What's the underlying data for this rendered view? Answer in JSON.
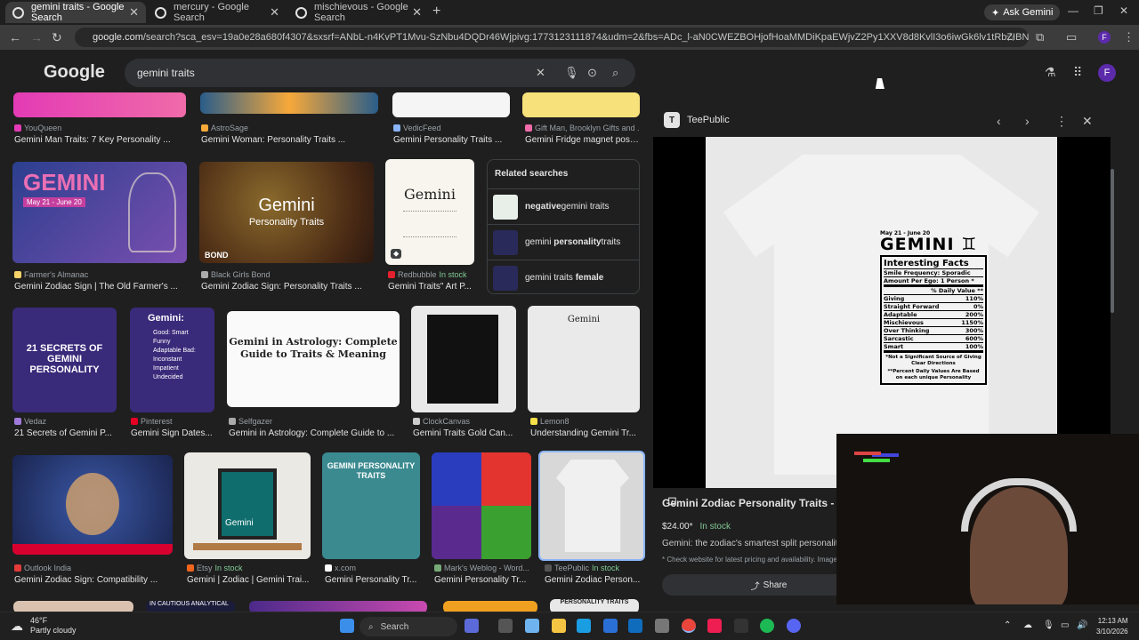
{
  "tabs": [
    {
      "title": "gemini traits - Google Search",
      "active": true
    },
    {
      "title": "mercury - Google Search",
      "active": false
    },
    {
      "title": "mischievous - Google Search",
      "active": false
    }
  ],
  "ask_gemini": "Ask Gemini",
  "url": {
    "host": "google.com",
    "path": "/search?sca_esv=19a0e28a680f4307&sxsrf=ANbL-n4KvPT1Mvu-SzNbu4DQDr46Wjpivg:1773123111874&udm=2&fbs=ADc_l-aN0CWEZBOHjofHoaMMDiKpaEWjvZ2Py1XXV8d8KvlI3o6iwGk6lv1tRbZIBNIVs-5-bUj3iBI-UxHsANYwOkWWI..."
  },
  "profile_initial": "F",
  "search": {
    "logo": "Google",
    "query": "gemini traits"
  },
  "row0": [
    {
      "source": "YouQueen",
      "title": "Gemini Man Traits: 7 Key Personality ...",
      "stock": ""
    },
    {
      "source": "AstroSage",
      "title": "Gemini Woman: Personality Traits ...",
      "stock": ""
    },
    {
      "source": "VedicFeed",
      "title": "Gemini Personality Traits ...",
      "stock": ""
    },
    {
      "source": "Gift Man, Brooklyn Gifts and ...",
      "title": "Gemini Fridge magnet posi...",
      "stock": ""
    }
  ],
  "row1": [
    {
      "source": "Farmer's Almanac",
      "title": "Gemini Zodiac Sign | The Old Farmer's ...",
      "stock": "",
      "img_text": "GEMINI",
      "img_sub": "May 21 - June 20"
    },
    {
      "source": "Black Girls Bond",
      "title": "Gemini Zodiac Sign: Personality Traits ...",
      "stock": "",
      "img_text": "Gemini",
      "img_sub": "Personality Traits",
      "img_mark": "BOND"
    },
    {
      "source": "Redbubble",
      "title": "Gemini Traits\" Art P...",
      "stock": "In stock",
      "img_text": "Gemini"
    }
  ],
  "related": {
    "heading": "Related searches",
    "items": [
      {
        "bold_prefix": "negative",
        "text": " gemini traits",
        "bold_suffix": ""
      },
      {
        "bold_prefix": "",
        "text": "gemini ",
        "bold_suffix": "personality",
        "tail": " traits"
      },
      {
        "bold_prefix": "",
        "text": "gemini traits ",
        "bold_suffix": "female",
        "tail": ""
      }
    ]
  },
  "row2": [
    {
      "source": "Vedaz",
      "title": "21 Secrets of Gemini P...",
      "stock": "",
      "img_text": "21 SECRETS OF GEMINI PERSONALITY"
    },
    {
      "source": "Pinterest",
      "title": "Gemini Sign Dates...",
      "stock": "",
      "img_text": "Gemini:",
      "img_lines": "Good: Smart Funny Adaptable Bad: Inconstant Impatient Undecided"
    },
    {
      "source": "Selfgazer",
      "title": "Gemini in Astrology: Complete Guide to ...",
      "stock": "",
      "img_text": "Gemini in Astrology: Complete Guide to Traits & Meaning"
    },
    {
      "source": "ClockCanvas",
      "title": "Gemini Traits Gold Can...",
      "stock": ""
    },
    {
      "source": "Lemon8",
      "title": "Understanding Gemini Tr...",
      "stock": "",
      "img_text": "Gemini"
    }
  ],
  "row3": [
    {
      "source": "Outlook India",
      "title": "Gemini Zodiac Sign: Compatibility ...",
      "stock": ""
    },
    {
      "source": "Etsy",
      "title": "Gemini | Zodiac | Gemini Trai...",
      "stock": "In stock",
      "img_text": "Gemini"
    },
    {
      "source": "x.com",
      "title": "Gemini Personality Tr...",
      "stock": "",
      "img_text": "GEMINI PERSONALITY TRAITS"
    },
    {
      "source": "Mark's Weblog - Word...",
      "title": "Gemini Personality Tr...",
      "stock": ""
    },
    {
      "source": "TeePublic",
      "title": "Gemini Zodiac Person...",
      "stock": "In stock"
    }
  ],
  "row4_partial": {
    "text1": "IN CAUTIOUS ANALYTICAL",
    "text2": "PERSONALITY TRAITS"
  },
  "panel": {
    "site": "TeePublic",
    "title": "Gemini Zodiac Personality Traits - Ma",
    "price": "$24.00*",
    "stock": "In stock",
    "description": "Gemini: the zodiac's smartest split personality. A",
    "note": "* Check website for latest pricing and availability. Image",
    "share": "Share",
    "shirt": {
      "dates": "May 21 - June 20",
      "sign": "GEMINI ♊",
      "box_title": "Interesting Facts",
      "facts": [
        {
          "label": "Smile Frequency: Sporadic",
          "value": ""
        },
        {
          "label": "Amount Per Ego: 1 Person *",
          "value": ""
        },
        {
          "label": "",
          "value": "% Daily Value **"
        },
        {
          "label": "Giving",
          "value": "110%"
        },
        {
          "label": "Straight Forward",
          "value": "0%"
        },
        {
          "label": "Adaptable",
          "value": "200%"
        },
        {
          "label": "Mischievous",
          "value": "1150%"
        },
        {
          "label": "Over Thinking",
          "value": "300%"
        },
        {
          "label": "Sarcastic",
          "value": "600%"
        },
        {
          "label": "Smart",
          "value": "100%"
        }
      ],
      "foot1": "*Not a Significant Source of Giving Clear Directions",
      "foot2": "**Percent Daily Values Are Based on each unique Personality"
    }
  },
  "taskbar": {
    "temp": "46°F",
    "weather": "Partly cloudy",
    "search": "Search",
    "time": "12:13 AM",
    "date": "3/10/2026"
  },
  "colors": {
    "accent": "#8ab4f8",
    "in_stock": "#81c995",
    "background": "#1f1f1f"
  }
}
